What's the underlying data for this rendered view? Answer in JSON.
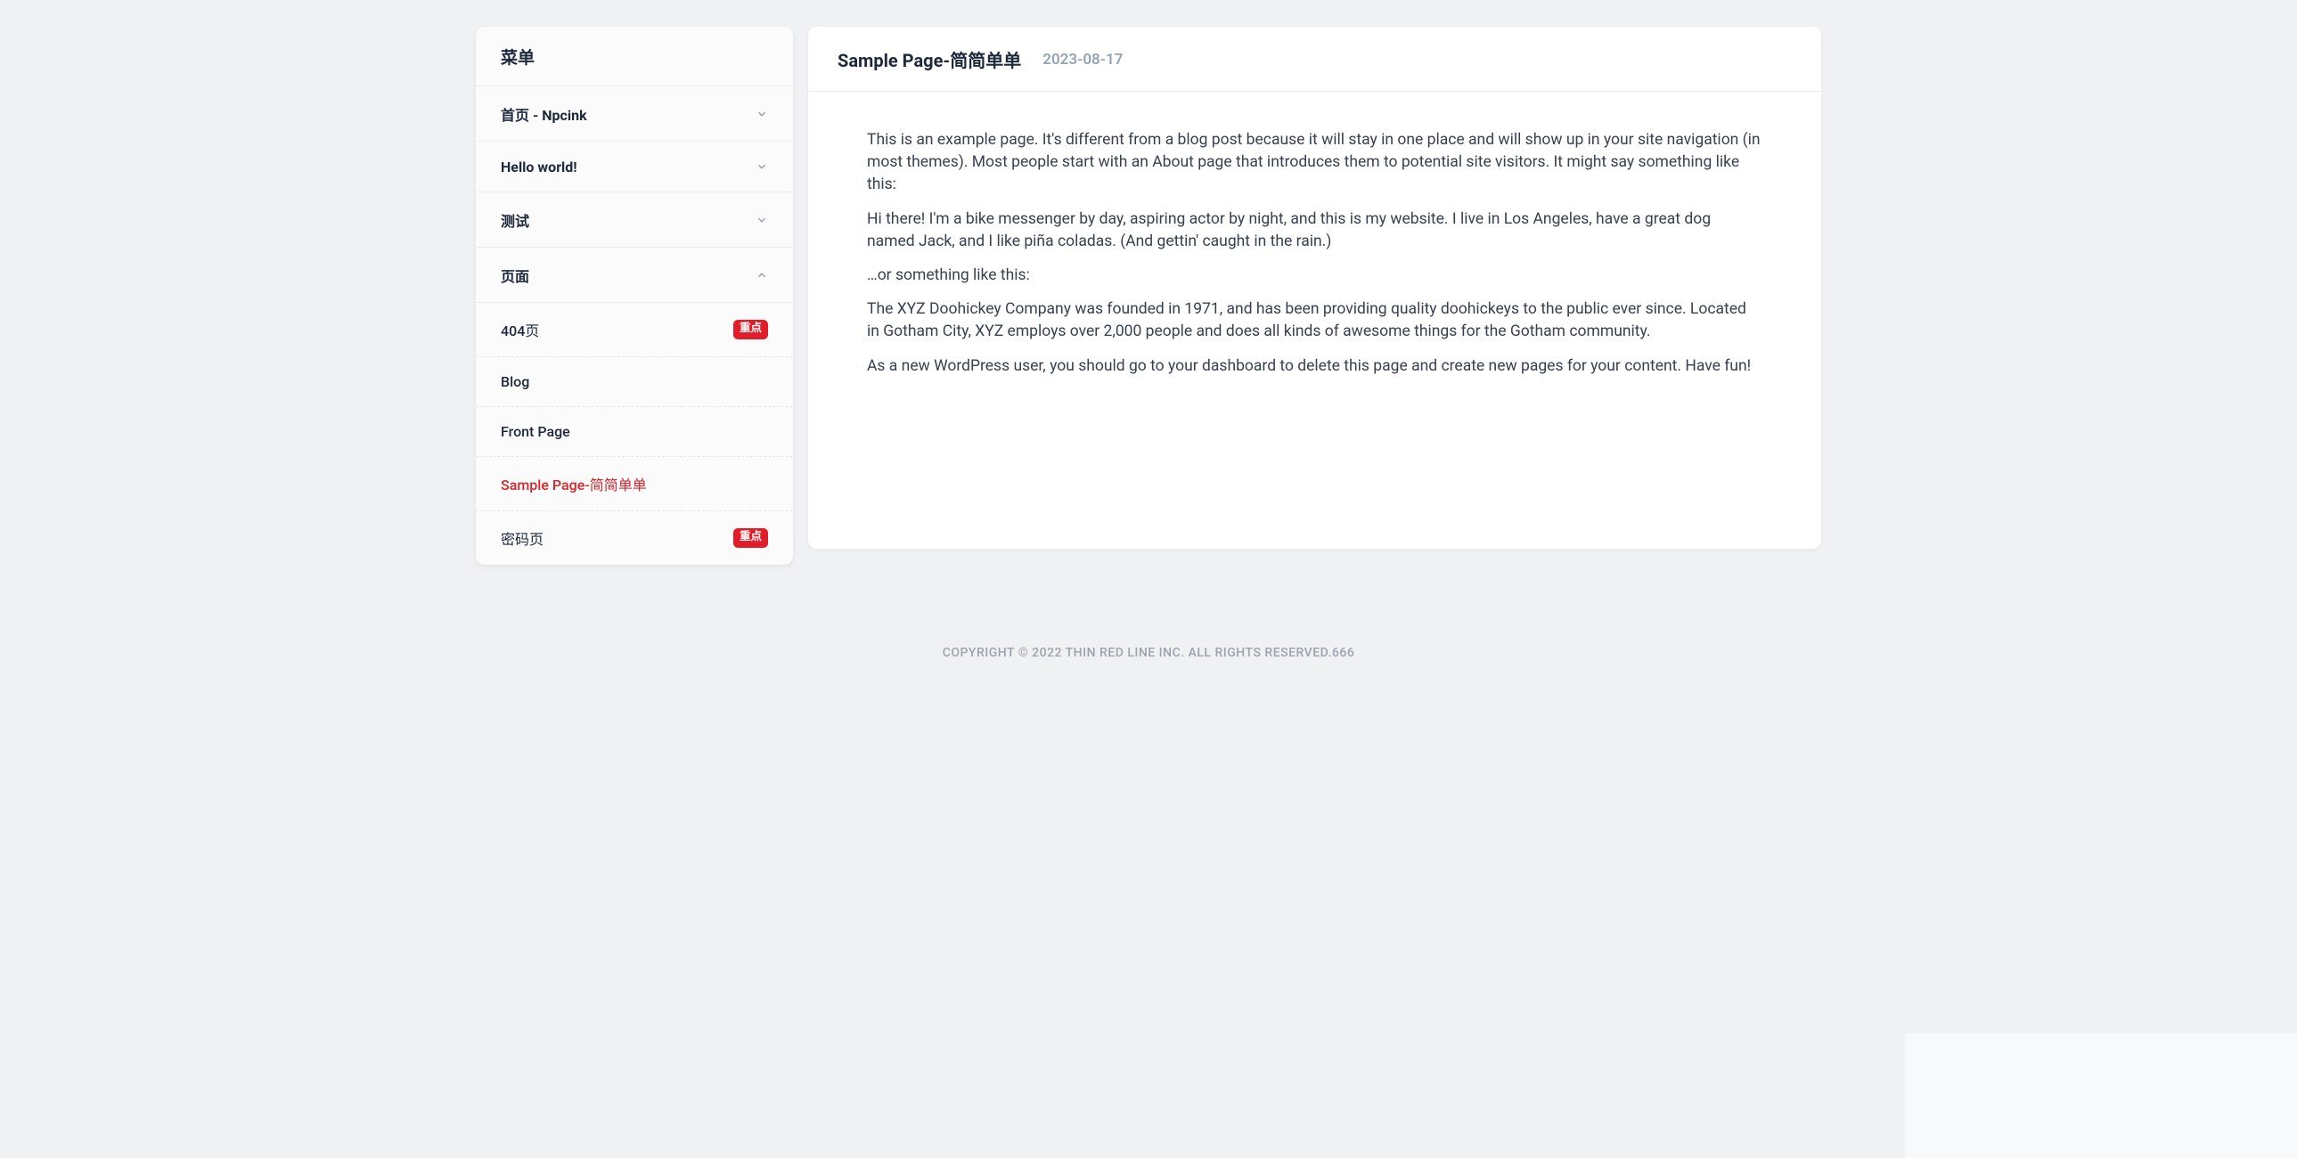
{
  "sidebar": {
    "header": "菜单",
    "items": [
      {
        "label": "首页 - Npcink",
        "expanded": false
      },
      {
        "label": "Hello world!",
        "expanded": false
      },
      {
        "label": "测试",
        "expanded": false
      },
      {
        "label": "页面",
        "expanded": true,
        "children": [
          {
            "label": "404页",
            "badge": "重点"
          },
          {
            "label": "Blog"
          },
          {
            "label": "Front Page"
          },
          {
            "label": "Sample Page-简简单单",
            "active": true
          },
          {
            "label": "密码页",
            "badge": "重点"
          }
        ]
      }
    ]
  },
  "main": {
    "title": "Sample Page-简简单单",
    "date": "2023-08-17",
    "paragraphs": [
      "This is an example page. It's different from a blog post because it will stay in one place and will show up in your site navigation (in most themes). Most people start with an About page that introduces them to potential site visitors. It might say something like this:",
      "Hi there! I'm a bike messenger by day, aspiring actor by night, and this is my website. I live in Los Angeles, have a great dog named Jack, and I like piña coladas. (And gettin' caught in the rain.)",
      "…or something like this:",
      "The XYZ Doohickey Company was founded in 1971, and has been providing quality doohickeys to the public ever since. Located in Gotham City, XYZ employs over 2,000 people and does all kinds of awesome things for the Gotham community.",
      "As a new WordPress user, you should go to your dashboard to delete this page and create new pages for your content. Have fun!"
    ]
  },
  "footer": "COPYRIGHT © 2022 THIN RED LINE INC. ALL RIGHTS RESERVED.666"
}
